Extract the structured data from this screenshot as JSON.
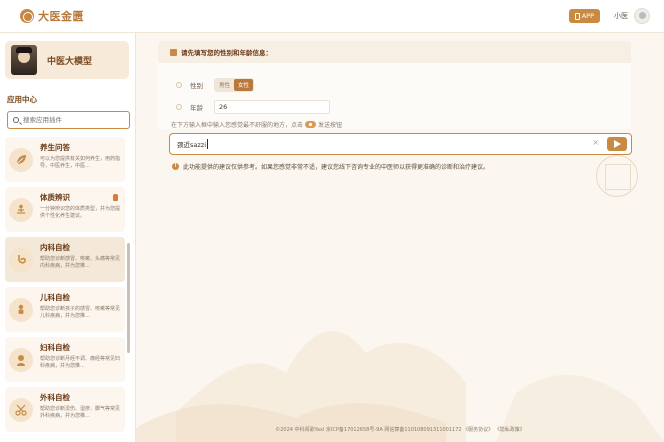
{
  "header": {
    "brand": "大医金匮",
    "app_button": "APP",
    "username": "小医"
  },
  "sidebar": {
    "model_name": "中医大模型",
    "section_title": "应用中心",
    "search_placeholder": "搜索应用插件",
    "apps": [
      {
        "title": "养生问答",
        "desc": "可以为您提供有关如何养生，用药指导，中医养生，中医..."
      },
      {
        "title": "体质辨识",
        "desc": "一分钟辨识您的体质类型，并为您提供个性化养生建议。"
      },
      {
        "title": "内科自检",
        "desc": "帮助您诊断感冒、咳嗽、头痛等常见内科疾病，并为您推..."
      },
      {
        "title": "儿科自检",
        "desc": "帮助您诊断孩子的感冒、咳嗽等常见儿科疾病，并为您推..."
      },
      {
        "title": "妇科自检",
        "desc": "帮助您诊断月经不调、痛经等常见妇科疾病，并为您推..."
      },
      {
        "title": "外科自检",
        "desc": "帮助您诊断烫伤、湿疹、脚气等常见外科疾病，并为您推..."
      }
    ]
  },
  "form": {
    "title": "请先填写您的性别和年龄信息：",
    "gender_label": "性别",
    "gender_options": [
      "男性",
      "女性"
    ],
    "gender_selected": "女性",
    "age_label": "年龄",
    "age_value": "26"
  },
  "chat": {
    "hint_before": "在下方输入框中输入您感觉最不舒服的地方，点击",
    "hint_after": "发送按钮",
    "input_value": "颈近sazzi",
    "clear_symbol": "×",
    "warning_text": "此功能提供的建议仅供参考。如果您感觉非常不适，建议您线下咨询专业的中医师以获得更准确的诊断和治疗建议。"
  },
  "footer": {
    "text": "©2024 中科闻歌Yaxi   京ICP备17012658号-9A   网信算备110108091311001172   《服务协议》   《隐私政策》"
  },
  "colors": {
    "accent": "#c98b44",
    "accent_dark": "#b8783e",
    "brand_text": "#7a4a20"
  }
}
